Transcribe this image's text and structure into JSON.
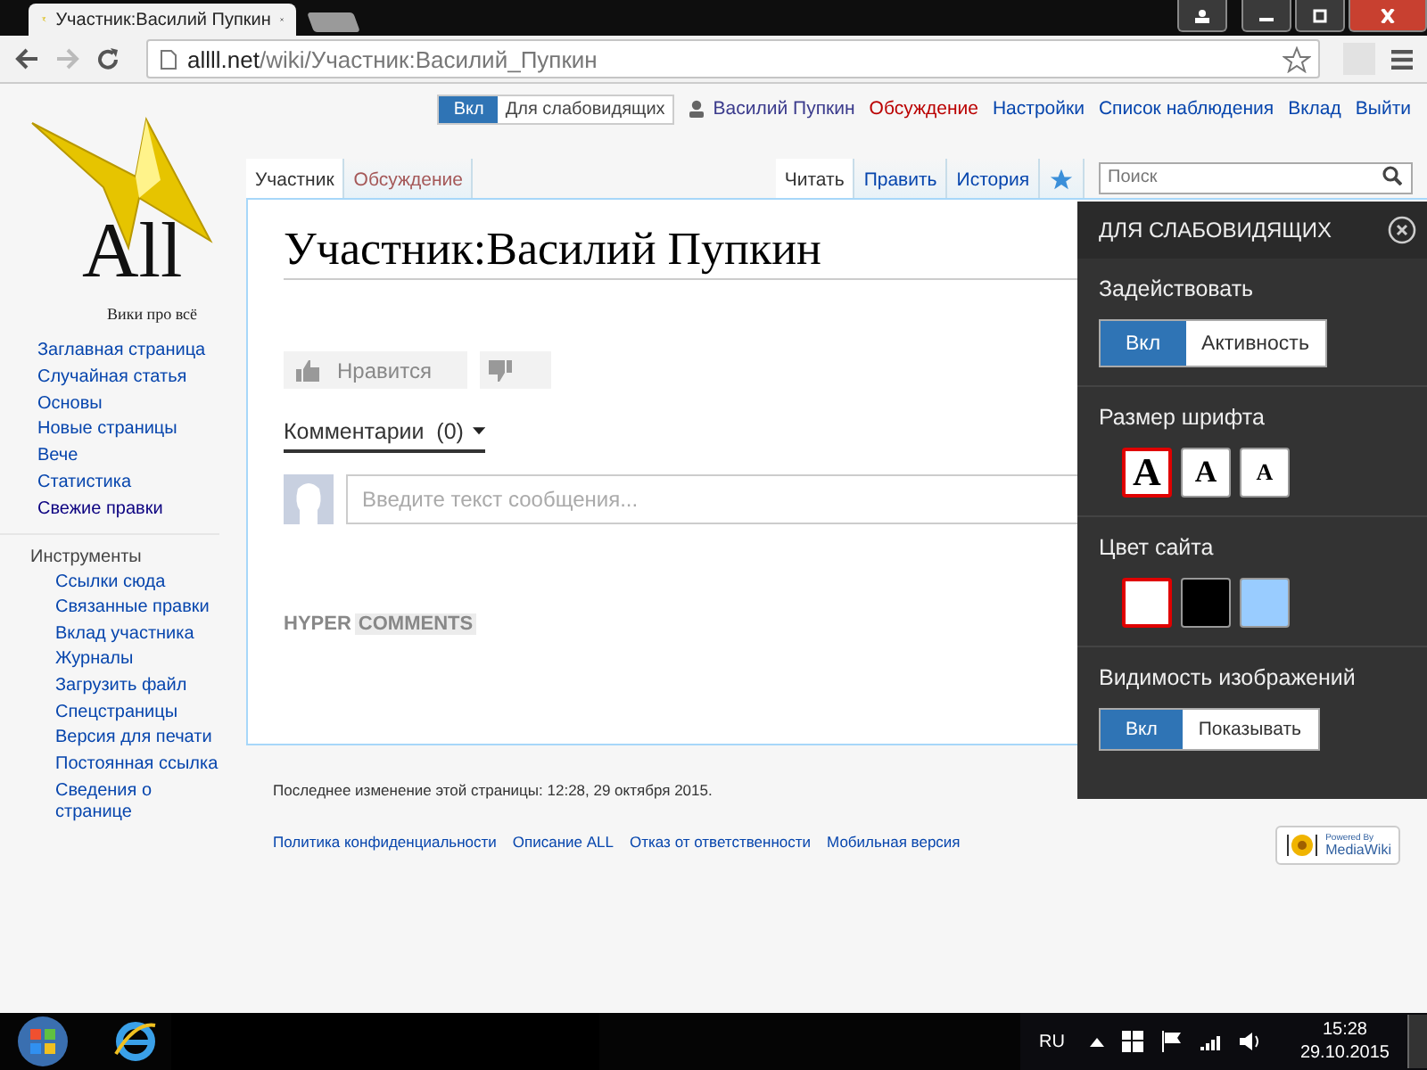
{
  "browser": {
    "tab_title": "Участник:Василий Пупкин",
    "url_host": "allll.net",
    "url_path": "/wiki/Участник:Василий_Пупкин"
  },
  "accessibility_toggle": {
    "on_label": "Вкл",
    "label": "Для слабовидящих"
  },
  "personal": [
    {
      "label": "Василий Пупкин",
      "kind": "user"
    },
    {
      "label": "Обсуждение",
      "kind": "new"
    },
    {
      "label": "Настройки",
      "kind": "link"
    },
    {
      "label": "Список наблюдения",
      "kind": "link"
    },
    {
      "label": "Вклад",
      "kind": "link"
    },
    {
      "label": "Выйти",
      "kind": "link"
    }
  ],
  "logo": {
    "text": "All",
    "tagline": "Вики про всё"
  },
  "namespaces": [
    {
      "label": "Участник",
      "selected": true
    },
    {
      "label": "Обсуждение",
      "selected": false
    }
  ],
  "views": [
    {
      "label": "Читать",
      "selected": true
    },
    {
      "label": "Править",
      "selected": false
    },
    {
      "label": "История",
      "selected": false
    }
  ],
  "search": {
    "placeholder": "Поиск"
  },
  "navigation": [
    {
      "label": "Заглавная страница",
      "visited": false
    },
    {
      "label": "Случайная статья",
      "visited": false
    },
    {
      "label": "Основы",
      "visited": false
    },
    {
      "label": "Новые страницы",
      "visited": false
    },
    {
      "label": "Вече",
      "visited": false
    },
    {
      "label": "Статистика",
      "visited": false
    },
    {
      "label": "Свежие правки",
      "visited": true
    }
  ],
  "tools": {
    "title": "Инструменты",
    "items": [
      "Ссылки сюда",
      "Связанные правки",
      "Вклад участника",
      "Журналы",
      "Загрузить файл",
      "Спецстраницы",
      "Версия для печати",
      "Постоянная ссылка",
      "Сведения о странице"
    ]
  },
  "page": {
    "title": "Участник:Василий Пупкин"
  },
  "comments": {
    "like": "Нравится",
    "label": "Комментарии",
    "count": "(0)",
    "placeholder": "Введите текст сообщения...",
    "brand_a": "HYPER",
    "brand_b": "COMMENTS"
  },
  "footer": {
    "last_modified": "Последнее изменение этой страницы: 12:28, 29 октября 2015.",
    "links": [
      "Политика конфиденциальности",
      "Описание ALL",
      "Отказ от ответственности",
      "Мобильная версия"
    ],
    "powered": "Powered By",
    "mediawiki": "MediaWiki"
  },
  "panel": {
    "title": "ДЛЯ СЛАБОВИДЯЩИХ",
    "sections": [
      {
        "kind": "toggle",
        "title": "Задействовать",
        "options": [
          {
            "label": "Вкл",
            "selected": true
          },
          {
            "label": "Активность",
            "selected": false
          }
        ]
      },
      {
        "kind": "font",
        "title": "Размер шрифта",
        "options": [
          {
            "label": "A",
            "selected": true
          },
          {
            "label": "A",
            "selected": false
          },
          {
            "label": "A",
            "selected": false
          }
        ]
      },
      {
        "kind": "color",
        "title": "Цвет сайта",
        "options": [
          {
            "color": "#ffffff",
            "selected": true
          },
          {
            "color": "#000000",
            "selected": false
          },
          {
            "color": "#99ccff",
            "selected": false
          }
        ]
      },
      {
        "kind": "toggle",
        "title": "Видимость изображений",
        "options": [
          {
            "label": "Вкл",
            "selected": true
          },
          {
            "label": "Показывать",
            "selected": false
          }
        ]
      }
    ]
  },
  "taskbar": {
    "language": "RU",
    "time": "15:28",
    "date": "29.10.2015"
  }
}
